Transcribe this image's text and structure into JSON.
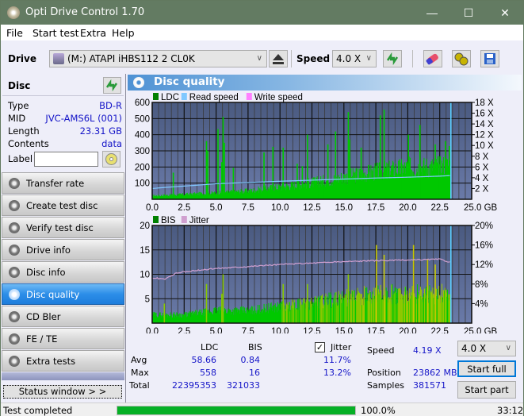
{
  "window": {
    "title": "Opti Drive Control 1.70",
    "minimize_glyph": "—",
    "maximize_glyph": "☐",
    "close_glyph": "✕"
  },
  "menu": [
    {
      "label": "File"
    },
    {
      "label": "Start test"
    },
    {
      "label": "Extra"
    },
    {
      "label": "Help"
    }
  ],
  "toolbar": {
    "drive_label": "Drive",
    "drive_value": "(M:)  ATAPI iHBS112  2 CL0K",
    "speed_label": "Speed",
    "speed_value": "4.0 X",
    "icons": [
      "eject-icon",
      "refresh-icon",
      "eraser-icon",
      "settings-icon",
      "save-icon"
    ]
  },
  "disc": {
    "header": "Disc",
    "rows": [
      {
        "key": "Type",
        "value": "BD-R"
      },
      {
        "key": "MID",
        "value": "JVC-AMS6L (001)"
      },
      {
        "key": "Length",
        "value": "23.31 GB"
      },
      {
        "key": "Contents",
        "value": "data"
      }
    ],
    "label_key": "Label",
    "label_value": ""
  },
  "nav": [
    {
      "label": "Transfer rate",
      "active": false
    },
    {
      "label": "Create test disc",
      "active": false
    },
    {
      "label": "Verify test disc",
      "active": false
    },
    {
      "label": "Drive info",
      "active": false
    },
    {
      "label": "Disc info",
      "active": false
    },
    {
      "label": "Disc quality",
      "active": true
    },
    {
      "label": "CD Bler",
      "active": false
    },
    {
      "label": "FE / TE",
      "active": false
    },
    {
      "label": "Extra tests",
      "active": false
    }
  ],
  "status_window_label": "Status window > >",
  "panel_title": "Disc quality",
  "colors": {
    "ldc": "#00c800",
    "read_speed": "#80c8ff",
    "write_speed": "#ff80ff",
    "bis": "#00c800",
    "jitter": "#d0a0d0",
    "plot_bg_top": "#4a5a80",
    "plot_bg_bottom": "#6a7aa8",
    "accent_blue": "#1515c8"
  },
  "chart_data": [
    {
      "type": "bar",
      "title": "LDC / Read speed",
      "legend": [
        "LDC",
        "Read speed",
        "Write speed"
      ],
      "legend_placement": "top-left",
      "xlabel": "GB",
      "x_ticks": [
        "0.0",
        "2.5",
        "5.0",
        "7.5",
        "10.0",
        "12.5",
        "15.0",
        "17.5",
        "20.0",
        "22.5",
        "25.0 GB"
      ],
      "xlim": [
        0,
        25
      ],
      "y_ticks_left": [
        "100",
        "200",
        "300",
        "400",
        "500",
        "600"
      ],
      "ylim_left": [
        0,
        600
      ],
      "y_ticks_right": [
        "2 X",
        "4 X",
        "6 X",
        "8 X",
        "10 X",
        "12 X",
        "14 X",
        "16 X",
        "18 X"
      ],
      "ylim_right": [
        0,
        18
      ],
      "grid": true,
      "data_end_gb": 23.31,
      "ldc_baseline": {
        "x": [
          0,
          2.5,
          5,
          7.5,
          10,
          12.5,
          15,
          17.5,
          20,
          22.5,
          23.31
        ],
        "y": [
          25,
          35,
          45,
          60,
          90,
          120,
          160,
          200,
          230,
          240,
          250
        ]
      },
      "ldc_spikes": [
        {
          "x": 1.6,
          "y": 165
        },
        {
          "x": 4.2,
          "y": 360
        },
        {
          "x": 4.3,
          "y": 300
        },
        {
          "x": 5.1,
          "y": 435
        },
        {
          "x": 5.5,
          "y": 510
        },
        {
          "x": 5.6,
          "y": 350
        },
        {
          "x": 5.4,
          "y": 230
        },
        {
          "x": 6.3,
          "y": 195
        },
        {
          "x": 8.7,
          "y": 290
        },
        {
          "x": 9.4,
          "y": 325
        },
        {
          "x": 10.2,
          "y": 320
        },
        {
          "x": 11.3,
          "y": 220
        },
        {
          "x": 11.7,
          "y": 205
        },
        {
          "x": 12.1,
          "y": 400
        },
        {
          "x": 13.7,
          "y": 340
        },
        {
          "x": 14.3,
          "y": 420
        },
        {
          "x": 15.3,
          "y": 540
        },
        {
          "x": 15.4,
          "y": 370
        },
        {
          "x": 16.3,
          "y": 320
        },
        {
          "x": 17.8,
          "y": 520
        },
        {
          "x": 18.1,
          "y": 555
        },
        {
          "x": 20.0,
          "y": 400
        },
        {
          "x": 20.9,
          "y": 460
        },
        {
          "x": 22.1,
          "y": 340
        },
        {
          "x": 22.9,
          "y": 360
        },
        {
          "x": 23.2,
          "y": 330
        }
      ],
      "read_speed": {
        "x": [
          0,
          1,
          2.5,
          4,
          5,
          7.5,
          10,
          12.5,
          15,
          17.5,
          20,
          22.5,
          23.31
        ],
        "y": [
          2.0,
          2.2,
          2.45,
          2.7,
          2.9,
          3.1,
          3.35,
          3.55,
          3.75,
          3.95,
          4.1,
          4.3,
          4.4
        ]
      }
    },
    {
      "type": "bar",
      "title": "BIS / Jitter",
      "legend": [
        "BIS",
        "Jitter"
      ],
      "legend_placement": "top-left",
      "xlabel": "GB",
      "x_ticks": [
        "0.0",
        "2.5",
        "5.0",
        "7.5",
        "10.0",
        "12.5",
        "15.0",
        "17.5",
        "20.0",
        "22.5",
        "25.0 GB"
      ],
      "xlim": [
        0,
        25
      ],
      "y_ticks_left": [
        "5",
        "10",
        "15",
        "20"
      ],
      "ylim_left": [
        0,
        20
      ],
      "y_ticks_right": [
        "4%",
        "8%",
        "12%",
        "16%",
        "20%"
      ],
      "ylim_right": [
        0,
        20
      ],
      "grid": true,
      "data_end_gb": 23.31,
      "bis_baseline": {
        "x": [
          0,
          2.5,
          5,
          7.5,
          10,
          12.5,
          15,
          17.5,
          20,
          22.5,
          23.31
        ],
        "y": [
          2,
          2,
          3,
          3,
          4,
          5,
          6,
          7,
          7,
          7,
          7
        ]
      },
      "bis_spikes": [
        {
          "x": 0.9,
          "y": 4
        },
        {
          "x": 4.2,
          "y": 8
        },
        {
          "x": 5.4,
          "y": 6
        },
        {
          "x": 5.5,
          "y": 10
        },
        {
          "x": 10.2,
          "y": 8
        },
        {
          "x": 12.1,
          "y": 8
        },
        {
          "x": 15.3,
          "y": 10
        },
        {
          "x": 17.5,
          "y": 16
        },
        {
          "x": 18.1,
          "y": 14
        },
        {
          "x": 20.4,
          "y": 16
        },
        {
          "x": 21.5,
          "y": 13
        },
        {
          "x": 22.1,
          "y": 12
        }
      ],
      "jitter": {
        "x": [
          0,
          1,
          1.8,
          2.5,
          5,
          7.5,
          10,
          12.5,
          15,
          17.5,
          20,
          22.5,
          23.31
        ],
        "y": [
          9.3,
          9.0,
          10.2,
          10.5,
          11.2,
          11.6,
          12.0,
          12.3,
          12.6,
          12.8,
          12.9,
          13.1,
          12.5
        ]
      }
    }
  ],
  "stats": {
    "col_ldc": "LDC",
    "col_bis": "BIS",
    "jitter_label": "Jitter",
    "jitter_checked": true,
    "rows": [
      {
        "label": "Avg",
        "ldc": "58.66",
        "bis": "0.84",
        "jitter": "11.7%"
      },
      {
        "label": "Max",
        "ldc": "558",
        "bis": "16",
        "jitter": "13.2%"
      },
      {
        "label": "Total",
        "ldc": "22395353",
        "bis": "321033",
        "jitter": ""
      }
    ],
    "speed_label": "Speed",
    "speed_value": "4.19 X",
    "position_label": "Position",
    "position_value": "23862 MB",
    "samples_label": "Samples",
    "samples_value": "381571",
    "speed_select": "4.0 X",
    "start_full": "Start full",
    "start_part": "Start part"
  },
  "statusbar": {
    "text": "Test completed",
    "progress_percent": 100.0,
    "progress_label": "100.0%",
    "time": "33:12"
  }
}
